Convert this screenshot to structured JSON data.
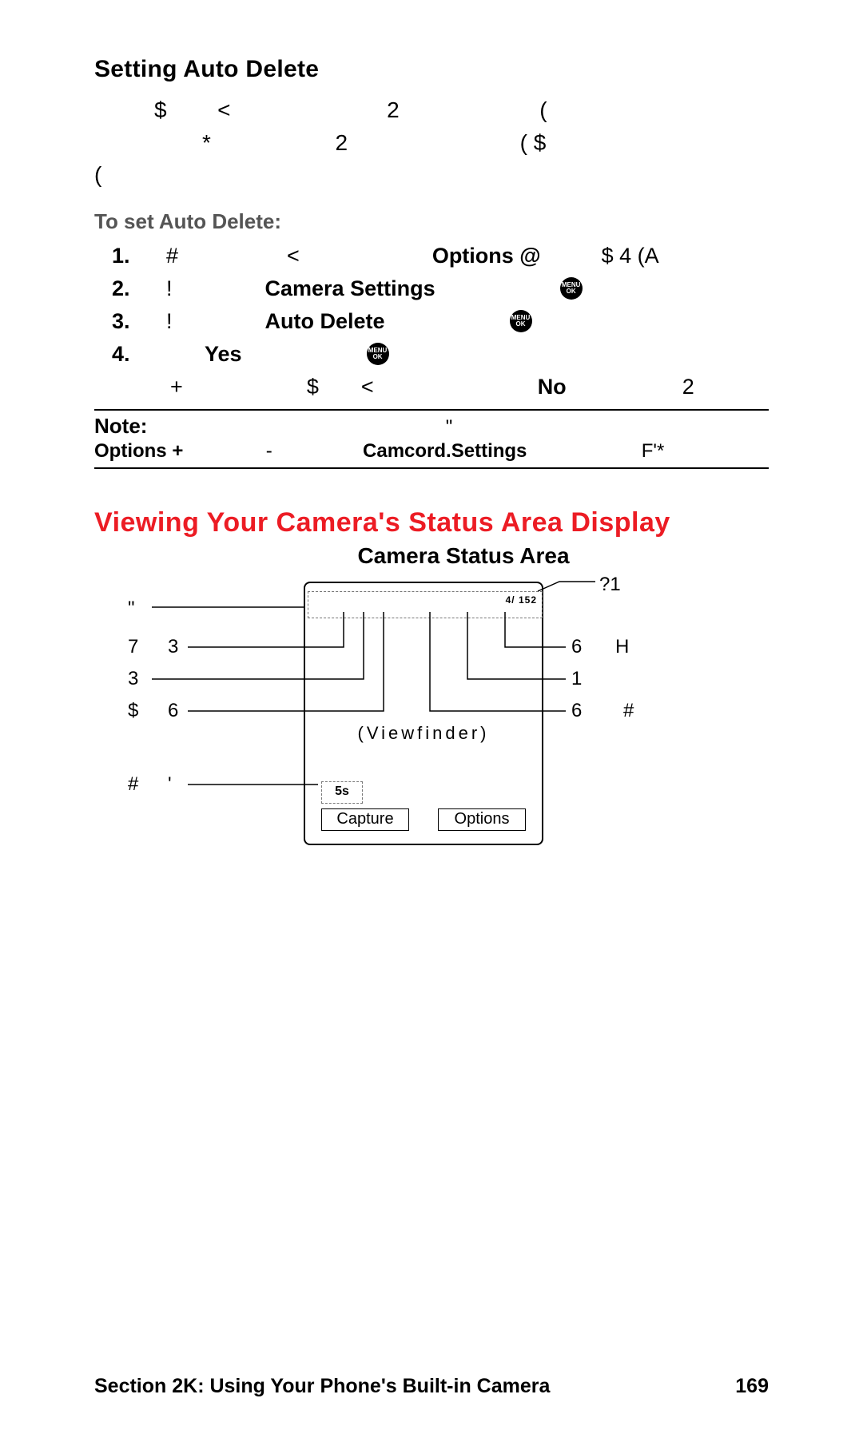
{
  "section_title": "Setting Auto Delete",
  "intro": {
    "line1_parts": [
      "$",
      "<",
      "2",
      "("
    ],
    "line2_parts": [
      "*",
      "2",
      "( $"
    ],
    "line3_parts": [
      "("
    ]
  },
  "subhead": "To set Auto Delete:",
  "steps": {
    "s1": {
      "num": "1.",
      "a": "#",
      "b": "<",
      "c": "Options @",
      "d": "$ 4 (A"
    },
    "s2": {
      "num": "2.",
      "a": "!",
      "b": "Camera Settings"
    },
    "s3": {
      "num": "3.",
      "a": "!",
      "b": "Auto Delete"
    },
    "s4": {
      "num": "4.",
      "a": "Yes"
    }
  },
  "after": {
    "parts": [
      "+",
      "$",
      "<",
      "No",
      "2"
    ]
  },
  "note": {
    "label": "Note:",
    "row1_tail": "\"",
    "row2": {
      "a": "Options +",
      "b": "-",
      "c": "Camcord.Settings",
      "d": "F'*"
    }
  },
  "menuok": {
    "top": "MENU",
    "bot": "OK"
  },
  "red_title": "Viewing Your Camera's Status Area Display",
  "csa_title": "Camera Status Area",
  "diagram": {
    "shot_count": "4/ 152",
    "viewfinder": "(Viewfinder)",
    "timer": "5s",
    "capture": "Capture",
    "options": "Options",
    "labels": {
      "l1": "\"",
      "l2a": "7",
      "l2b": "3",
      "l3": "3",
      "l4a": "$",
      "l4b": "6",
      "l5a": "#",
      "l5b": "'",
      "r0": "?1",
      "r1a": "6",
      "r1b": "H",
      "r2": "1",
      "r3a": "6",
      "r3b": "#"
    }
  },
  "footer": {
    "left": "Section 2K: Using Your Phone's Built-in Camera",
    "right": "169"
  }
}
